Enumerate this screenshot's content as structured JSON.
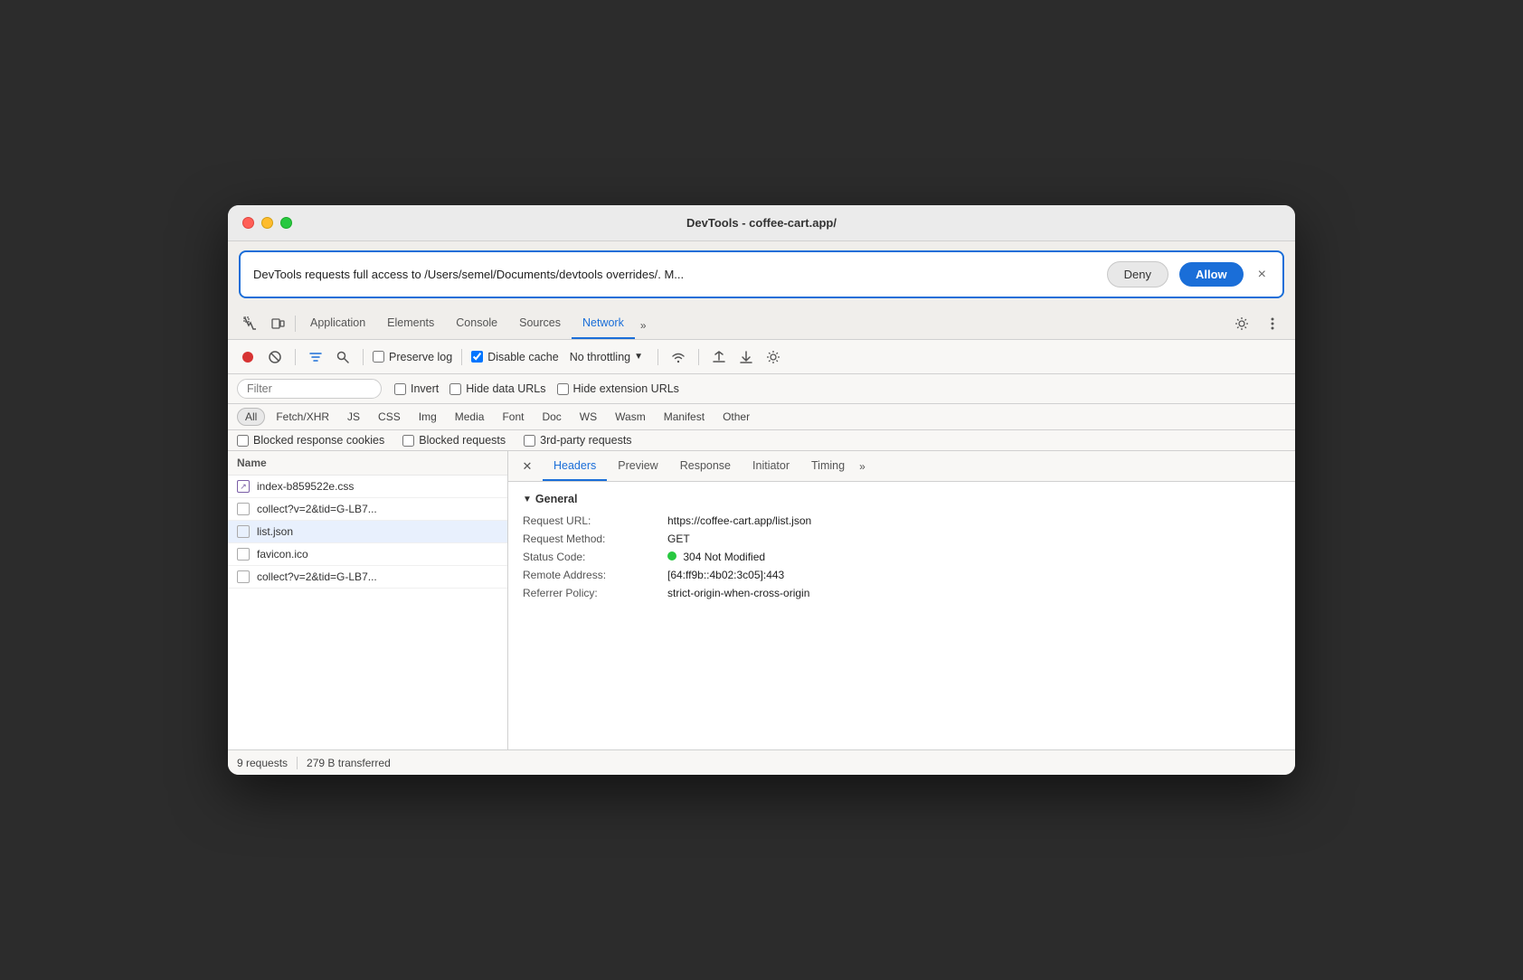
{
  "window": {
    "title": "DevTools - coffee-cart.app/"
  },
  "permission_banner": {
    "text": "DevTools requests full access to /Users/semel/Documents/devtools overrides/. M...",
    "deny_label": "Deny",
    "allow_label": "Allow",
    "close_label": "×"
  },
  "tabs": {
    "items": [
      {
        "label": "Application",
        "active": false
      },
      {
        "label": "Elements",
        "active": false
      },
      {
        "label": "Console",
        "active": false
      },
      {
        "label": "Sources",
        "active": false
      },
      {
        "label": "Network",
        "active": true
      }
    ],
    "more_label": "»"
  },
  "network_toolbar": {
    "preserve_log_label": "Preserve log",
    "preserve_log_checked": false,
    "disable_cache_label": "Disable cache",
    "disable_cache_checked": true,
    "throttling_label": "No throttling"
  },
  "filter_bar": {
    "filter_placeholder": "Filter",
    "invert_label": "Invert",
    "hide_data_urls_label": "Hide data URLs",
    "hide_extension_urls_label": "Hide extension URLs"
  },
  "type_filters": {
    "items": [
      {
        "label": "All",
        "active": true
      },
      {
        "label": "Fetch/XHR",
        "active": false
      },
      {
        "label": "JS",
        "active": false
      },
      {
        "label": "CSS",
        "active": false
      },
      {
        "label": "Img",
        "active": false
      },
      {
        "label": "Media",
        "active": false
      },
      {
        "label": "Font",
        "active": false
      },
      {
        "label": "Doc",
        "active": false
      },
      {
        "label": "WS",
        "active": false
      },
      {
        "label": "Wasm",
        "active": false
      },
      {
        "label": "Manifest",
        "active": false
      },
      {
        "label": "Other",
        "active": false
      }
    ]
  },
  "cookie_filters": {
    "blocked_cookies_label": "Blocked response cookies",
    "blocked_requests_label": "Blocked requests",
    "third_party_label": "3rd-party requests"
  },
  "file_list": {
    "header": "Name",
    "items": [
      {
        "name": "index-b859522e.css",
        "type": "css",
        "selected": false
      },
      {
        "name": "collect?v=2&tid=G-LB7...",
        "type": "normal",
        "selected": false
      },
      {
        "name": "list.json",
        "type": "normal",
        "selected": true
      },
      {
        "name": "favicon.ico",
        "type": "normal",
        "selected": false
      },
      {
        "name": "collect?v=2&tid=G-LB7...",
        "type": "normal",
        "selected": false
      }
    ]
  },
  "detail_panel": {
    "tabs": [
      {
        "label": "Headers",
        "active": true
      },
      {
        "label": "Preview",
        "active": false
      },
      {
        "label": "Response",
        "active": false
      },
      {
        "label": "Initiator",
        "active": false
      },
      {
        "label": "Timing",
        "active": false
      }
    ],
    "more_label": "»",
    "section_label": "General",
    "rows": [
      {
        "key": "Request URL:",
        "value": "https://coffee-cart.app/list.json"
      },
      {
        "key": "Request Method:",
        "value": "GET"
      },
      {
        "key": "Status Code:",
        "value": "304 Not Modified",
        "has_dot": true
      },
      {
        "key": "Remote Address:",
        "value": "[64:ff9b::4b02:3c05]:443"
      },
      {
        "key": "Referrer Policy:",
        "value": "strict-origin-when-cross-origin"
      }
    ]
  },
  "status_bar": {
    "requests": "9 requests",
    "transferred": "279 B transferred"
  }
}
